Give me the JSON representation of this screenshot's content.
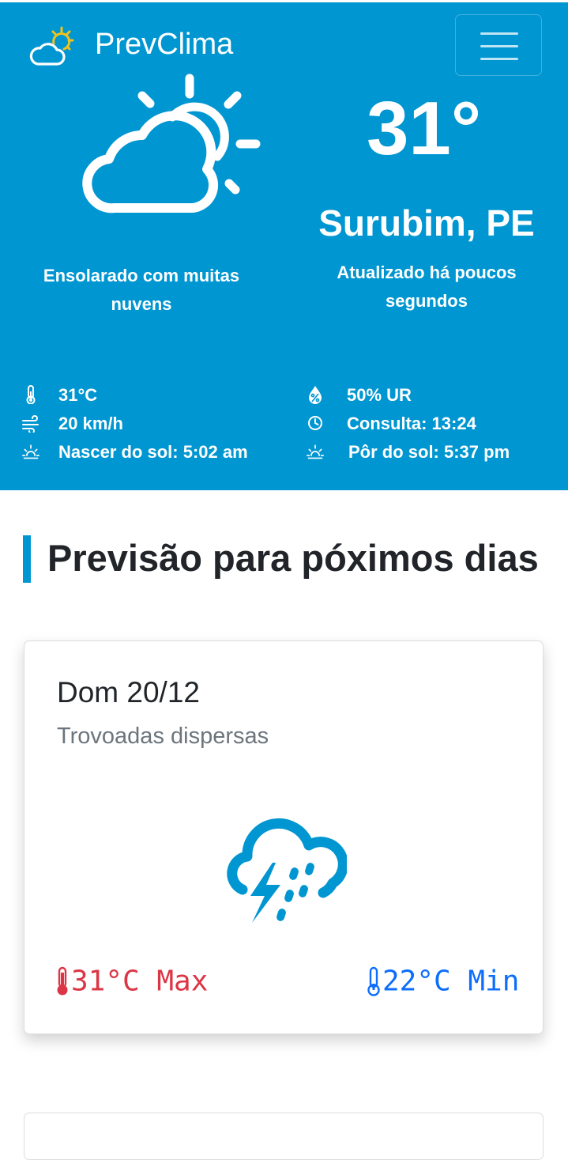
{
  "header": {
    "brand_name": "PrevClima",
    "brand_icon": "sun-cloud-icon",
    "menu_icon": "hamburger-icon"
  },
  "current": {
    "icon": "partly-cloudy-icon",
    "temperature": "31°",
    "city": "Surubim, PE",
    "condition": "Ensolarado com muitas nuvens",
    "updated": "Atualizado há poucos segundos"
  },
  "stats": {
    "temp": "31°C",
    "humidity": "50% UR",
    "wind": "20 km/h",
    "consulta": "Consulta: 13:24",
    "sunrise": "Nascer do sol: 5:02 am",
    "sunset": "Pôr do sol: 5:37 pm"
  },
  "forecast_section": {
    "title": "Previsão para póximos dias"
  },
  "forecast": [
    {
      "day": "Dom 20/12",
      "description": "Trovoadas dispersas",
      "icon": "thunderstorm-icon",
      "max": "31°C Max",
      "min": "22°C Min"
    }
  ],
  "colors": {
    "hero_bg": "#0096d1",
    "accent": "#0096d1",
    "max_temp": "#dc3545",
    "min_temp": "#0d6efd",
    "muted": "#6c757d"
  }
}
